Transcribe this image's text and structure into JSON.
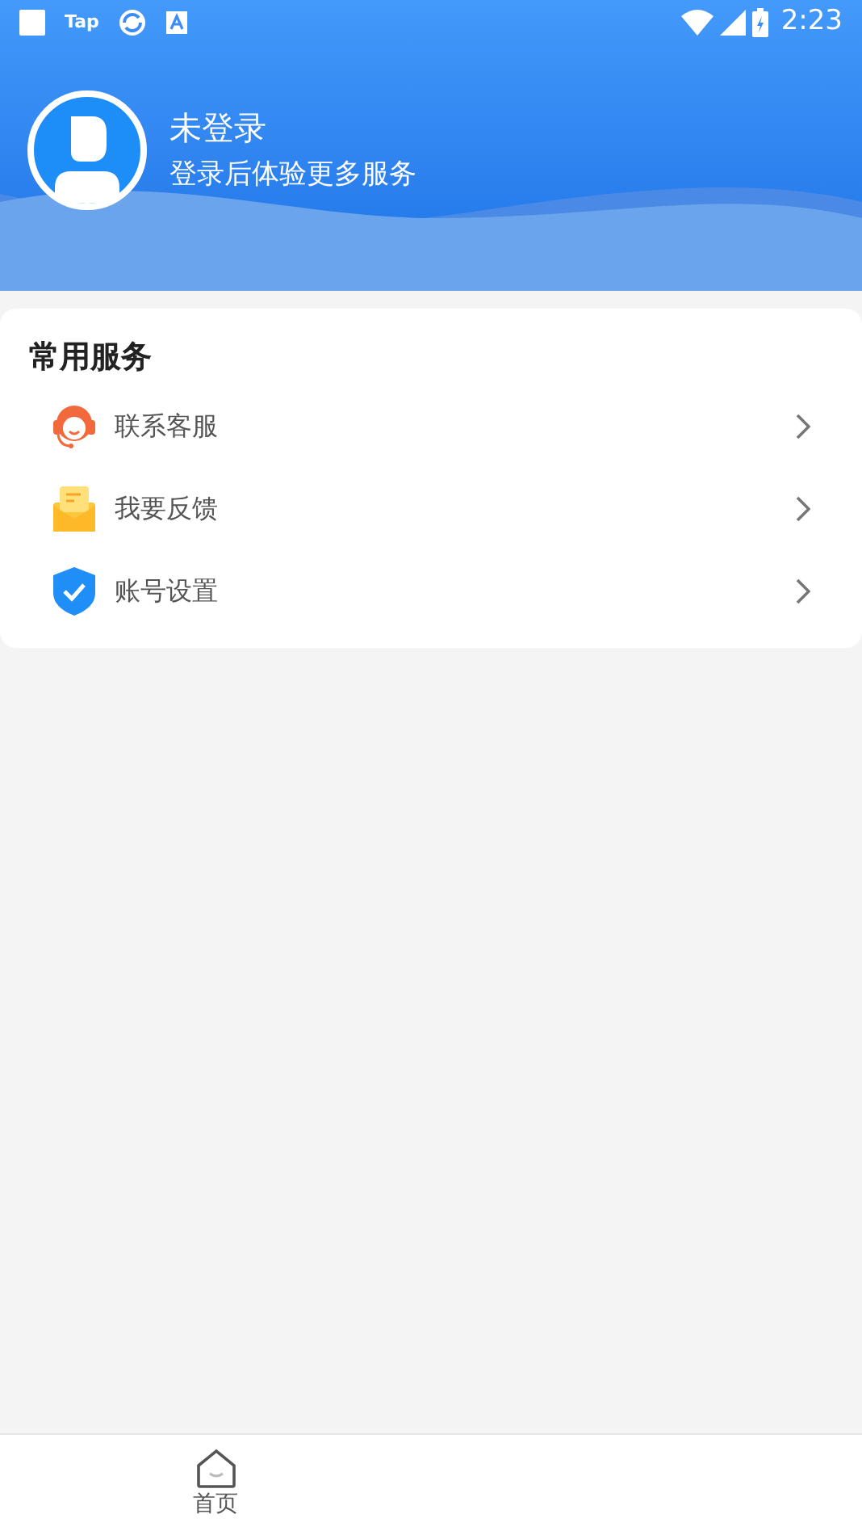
{
  "status_bar": {
    "app_label": "Tap",
    "time": "2:23"
  },
  "profile": {
    "name": "未登录",
    "subtitle": "登录后体验更多服务"
  },
  "services": {
    "title": "常用服务",
    "items": [
      {
        "kind": "headset",
        "label": "联系客服"
      },
      {
        "kind": "mail",
        "label": "我要反馈"
      },
      {
        "kind": "shield",
        "label": "账号设置"
      }
    ]
  },
  "tab_bar": [
    {
      "label": "首页",
      "selected": false
    }
  ]
}
